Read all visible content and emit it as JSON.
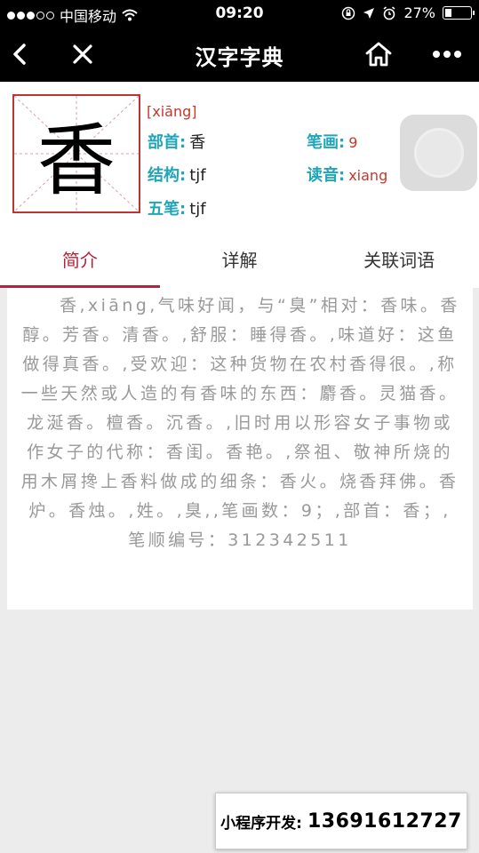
{
  "status_bar": {
    "carrier": "中国移动",
    "time": "09:20",
    "battery": "27%",
    "battery_level": 0.27
  },
  "nav": {
    "title": "汉字字典",
    "icons": [
      "back-arrow-icon",
      "close-icon",
      "home-icon",
      "more-icon"
    ]
  },
  "character": {
    "glyph": "香",
    "pinyin": "[xiāng]",
    "radical_label": "部首:",
    "radical_value": "香",
    "strokes_label": "笔画:",
    "strokes_value": "9",
    "structure_label": "结构:",
    "structure_value": "tjf",
    "reading_label": "读音:",
    "reading_value": "xiang",
    "wubi_label": "五笔:",
    "wubi_value": "tjf"
  },
  "tabs": [
    {
      "label": "简介",
      "active": true
    },
    {
      "label": "详解",
      "active": false
    },
    {
      "label": "关联词语",
      "active": false
    }
  ],
  "content": {
    "text": "　　香,xiāng,气味好闻，与“臭”相对：香味。香醇。芳香。清香。,舒服：睡得香。,味道好：这鱼做得真香。,受欢迎：这种货物在农村香得很。,称一些天然或人造的有香味的东西：麝香。灵猫香。龙涎香。檀香。沉香。,旧时用以形容女子事物或作女子的代称：香闺。香艳。,祭祖、敬神所烧的用木屑搀上香料做成的细条：香火。烧香拜佛。香炉。香烛。,姓。,臭,,笔画数：9；,部首：香；,笔顺编号：312342511"
  },
  "banner": {
    "label": "小程序开发:",
    "phone": "13691612727"
  },
  "colors": {
    "accent_red": "#b2243a",
    "label_teal": "#20a6b8",
    "pinyin_red": "#c0392b"
  }
}
